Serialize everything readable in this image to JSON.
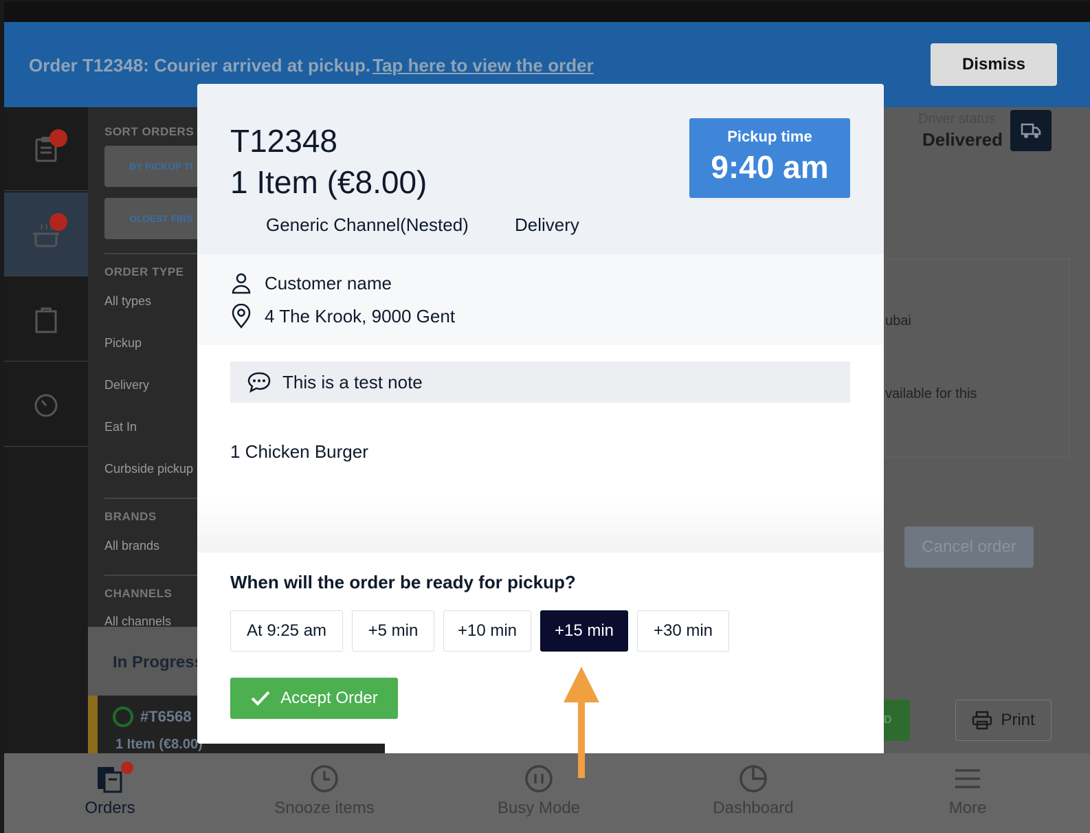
{
  "banner": {
    "message": "Order T12348: Courier arrived at pickup.",
    "link": "Tap here to view the order",
    "dismiss": "Dismiss"
  },
  "filters": {
    "sort_heading": "SORT ORDERS",
    "sort_by_pickup": "BY PICKUP TI",
    "sort_oldest": "OLDEST FIRS",
    "order_type_heading": "ORDER TYPE",
    "order_types": [
      "All types",
      "Pickup",
      "Delivery",
      "Eat In",
      "Curbside pickup"
    ],
    "brands_heading": "BRANDS",
    "brands_value": "All brands",
    "channels_heading": "CHANNELS",
    "channels_value": "All channels"
  },
  "in_progress": {
    "label": "In Progress",
    "order_number": "#T6568",
    "order_amount": "1 Item  (€8.00)"
  },
  "background_right": {
    "driver_status_label": "Driver status",
    "driver_status_value": "Delivered",
    "text_1": "ubai",
    "text_2": "vailable for this",
    "cancel_order": "Cancel order",
    "green_button_stub": "D",
    "print": "Print"
  },
  "modal": {
    "order_id": "T12348",
    "item_summary": "1 Item (€8.00)",
    "channel": "Generic Channel(Nested)",
    "order_type": "Delivery",
    "pickup_label": "Pickup time",
    "pickup_time": "9:40 am",
    "customer_name": "Customer name",
    "address": "4 The Krook, 9000 Gent",
    "note": "This is a test note",
    "item_line": "1 Chicken Burger",
    "question": "When will the order be ready for pickup?",
    "time_options": [
      "At 9:25 am",
      "+5 min",
      "+10 min",
      "+15 min",
      "+30 min"
    ],
    "selected_option": "+15 min",
    "accept_label": "Accept Order"
  },
  "tabbar": {
    "tabs": [
      "Orders",
      "Snooze items",
      "Busy Mode",
      "Dashboard",
      "More"
    ],
    "active": "Orders"
  },
  "colors": {
    "banner_bg": "#1d5fa0",
    "pickup_box": "#3f86d9",
    "selected_option_bg": "#0a0d2e",
    "accept_bg": "#4caf50",
    "arrow": "#f0a040",
    "notification_dot": "#b3261e"
  }
}
